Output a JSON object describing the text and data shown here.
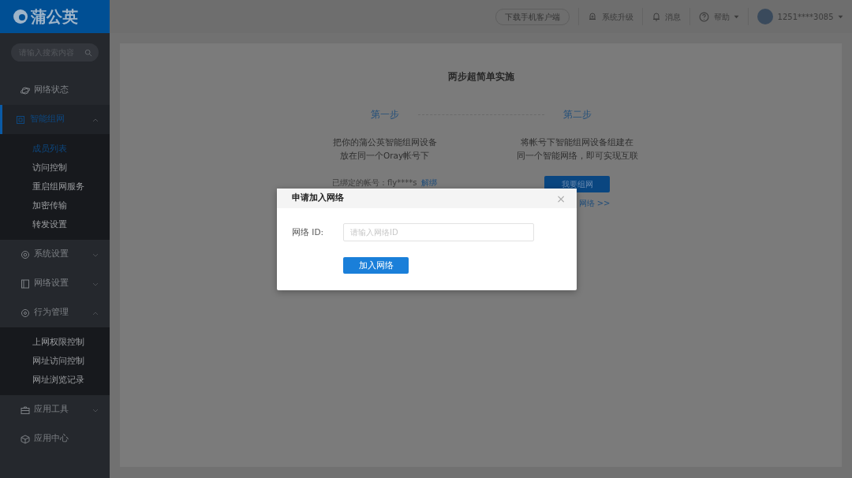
{
  "brand": {
    "name": "蒲公英"
  },
  "search": {
    "placeholder": "请输入搜索内容"
  },
  "sidebar": {
    "items": [
      {
        "label": "网络状态",
        "selected": false
      },
      {
        "label": "智能组网",
        "selected": true,
        "expanded": true,
        "children": [
          {
            "label": "成员列表",
            "selected": true
          },
          {
            "label": "访问控制",
            "selected": false
          },
          {
            "label": "重启组网服务",
            "selected": false
          },
          {
            "label": "加密传输",
            "selected": false
          },
          {
            "label": "转发设置",
            "selected": false
          }
        ]
      },
      {
        "label": "系统设置",
        "selected": false,
        "expanded": false
      },
      {
        "label": "网络设置",
        "selected": false,
        "expanded": false
      },
      {
        "label": "行为管理",
        "selected": false,
        "expanded": true,
        "children": [
          {
            "label": "上网权限控制",
            "selected": false
          },
          {
            "label": "网址访问控制",
            "selected": false
          },
          {
            "label": "网址浏览记录",
            "selected": false
          }
        ]
      },
      {
        "label": "应用工具",
        "selected": false,
        "expanded": false
      },
      {
        "label": "应用中心",
        "selected": false
      }
    ]
  },
  "header": {
    "download": "下载手机客户端",
    "upgrade": "系统升级",
    "messages": "消息",
    "help": "帮助",
    "user": "1251****3085"
  },
  "main": {
    "title": "两步超简单实施",
    "steps": [
      {
        "label": "第一步",
        "lines": [
          "把你的蒲公英智能组网设备",
          "放在同一个Oray帐号下"
        ]
      },
      {
        "label": "第二步",
        "lines": [
          "将帐号下智能组网设备组建在",
          "同一个智能网络，即可实现互联"
        ]
      }
    ],
    "bound_account": "已绑定的帐号：fly****s",
    "unbind": "解绑",
    "create_button": "我要组网",
    "join_link": "网络 >>"
  },
  "dialog": {
    "title": "申请加入网络",
    "close": "×",
    "field_label": "网络 ID:",
    "placeholder": "请输入网络ID",
    "submit": "加入网络"
  }
}
